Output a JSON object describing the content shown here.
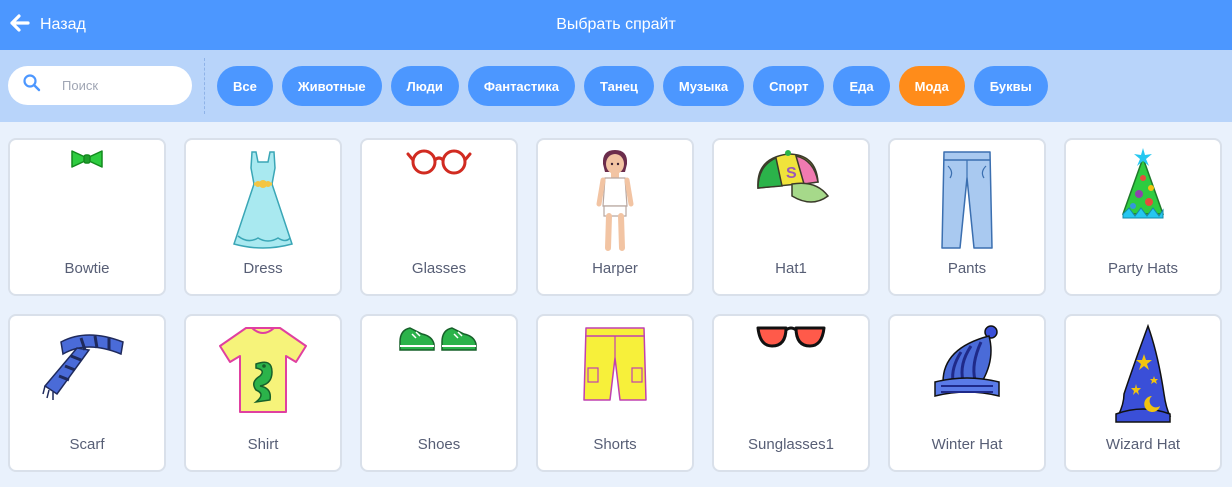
{
  "header": {
    "back_label": "Назад",
    "title": "Выбрать спрайт"
  },
  "search": {
    "placeholder": "Поиск"
  },
  "tags": [
    "Все",
    "Животные",
    "Люди",
    "Фантастика",
    "Танец",
    "Музыка",
    "Спорт",
    "Еда",
    "Мода",
    "Буквы"
  ],
  "active_tag": "Мода",
  "sprites": [
    {
      "name": "Bowtie",
      "icon": "bowtie-icon"
    },
    {
      "name": "Dress",
      "icon": "dress-icon"
    },
    {
      "name": "Glasses",
      "icon": "glasses-icon"
    },
    {
      "name": "Harper",
      "icon": "harper-icon"
    },
    {
      "name": "Hat1",
      "icon": "cap-icon"
    },
    {
      "name": "Pants",
      "icon": "pants-icon"
    },
    {
      "name": "Party Hats",
      "icon": "party-hat-icon"
    },
    {
      "name": "Scarf",
      "icon": "scarf-icon"
    },
    {
      "name": "Shirt",
      "icon": "shirt-icon"
    },
    {
      "name": "Shoes",
      "icon": "shoes-icon"
    },
    {
      "name": "Shorts",
      "icon": "shorts-icon"
    },
    {
      "name": "Sunglasses1",
      "icon": "sunglasses-icon"
    },
    {
      "name": "Winter Hat",
      "icon": "winter-hat-icon"
    },
    {
      "name": "Wizard Hat",
      "icon": "wizard-hat-icon"
    }
  ],
  "colors": {
    "header": "#4c97ff",
    "filterbar": "#b8d4fa",
    "active_tag": "#ff8c1a",
    "background": "#e9f1fc"
  }
}
